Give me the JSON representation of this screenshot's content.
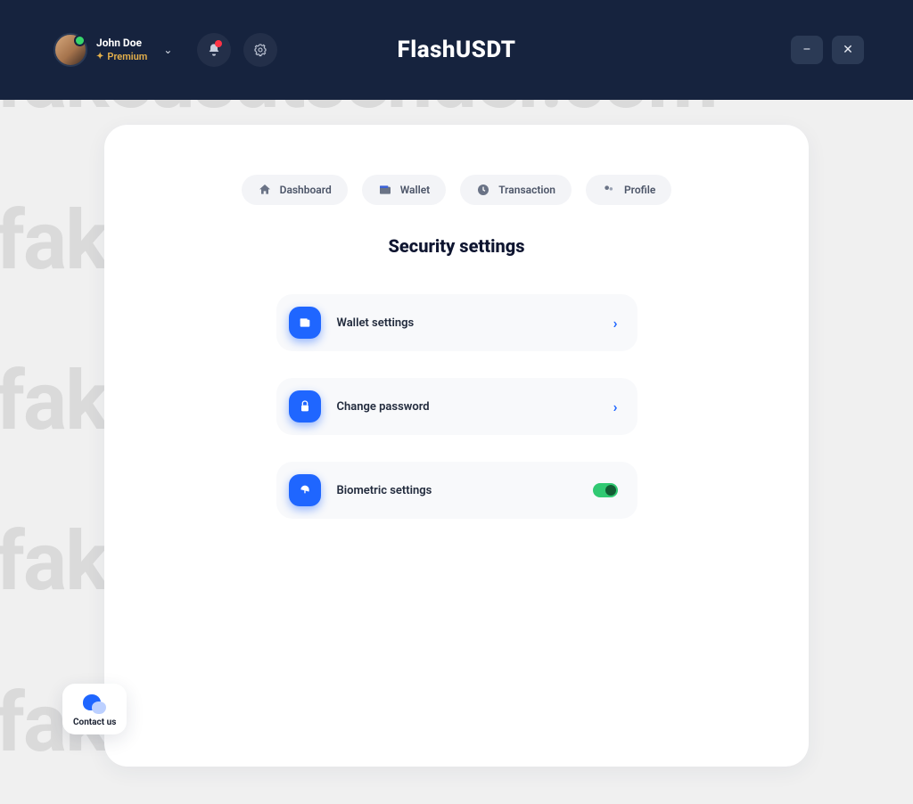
{
  "header": {
    "user_name": "John Doe",
    "user_plan": "Premium",
    "brand": "FlashUSDT"
  },
  "tabs": {
    "dashboard": "Dashboard",
    "wallet": "Wallet",
    "transaction": "Transaction",
    "profile": "Profile"
  },
  "page_title": "Security settings",
  "settings": {
    "wallet": "Wallet settings",
    "password": "Change password",
    "biometric": "Biometric settings"
  },
  "contact_label": "Contact us",
  "watermark_text": "fakeusdtsender.com"
}
